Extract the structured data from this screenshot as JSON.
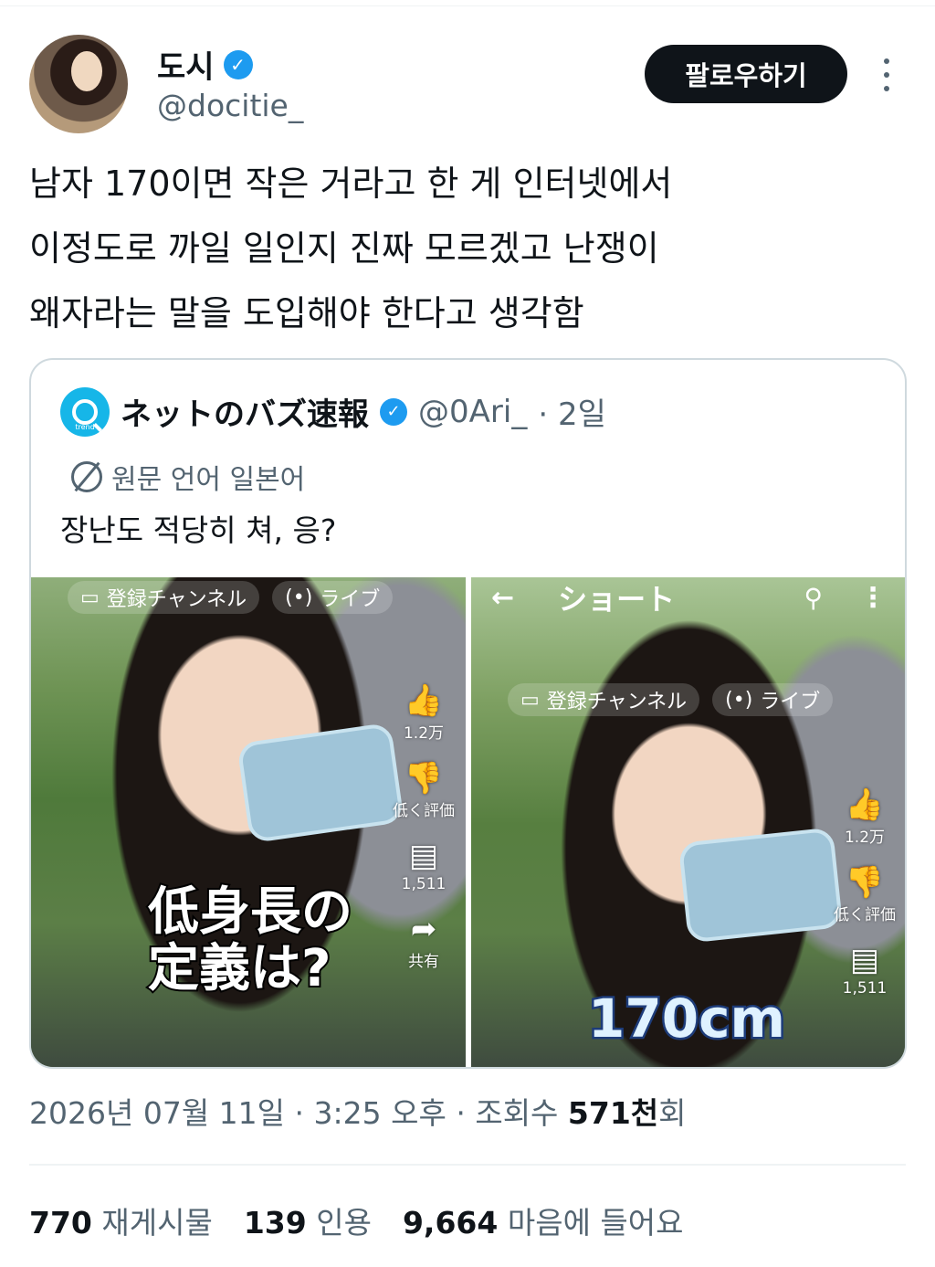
{
  "header": {
    "display_name": "도시",
    "handle": "@docitie_",
    "follow_label": "팔로우하기"
  },
  "tweet": {
    "lines": [
      "남자 170이면 작은 거라고 한 게 인터넷에서",
      "이정도로 까일 일인지 진짜 모르겠고 난쟁이",
      "왜자라는 말을 도입해야 한다고 생각함"
    ]
  },
  "quote": {
    "name": "ネットのバズ速報",
    "handle": "@0Ari_",
    "time": "· 2일",
    "avatar_label": "trend",
    "language_note": "원문 언어 일본어",
    "text": "장난도 적당히 쳐, 응?",
    "media_left": {
      "top_bar": [
        "登録チャンネル",
        "ライブ"
      ],
      "rail": [
        {
          "icon": "thumbs-up-icon",
          "label": "1.2万"
        },
        {
          "icon": "thumbs-down-icon",
          "label": "低く評価"
        },
        {
          "icon": "comment-icon",
          "label": "1,511"
        },
        {
          "icon": "share-icon",
          "label": "共有"
        }
      ],
      "caption_line1": "低身長の",
      "caption_line2": "定義は?"
    },
    "media_right": {
      "bar_title": "ショート",
      "top_bar": [
        "登録チャンネル",
        "ライブ"
      ],
      "rail": [
        {
          "icon": "thumbs-up-icon",
          "label": "1.2万"
        },
        {
          "icon": "thumbs-down-icon",
          "label": "低く評価"
        },
        {
          "icon": "comment-icon",
          "label": "1,511"
        }
      ],
      "caption": "170cm"
    }
  },
  "meta": {
    "date": "2026년 07월 11일",
    "time": "3:25 오후",
    "views_prefix": "조회수",
    "views_value": "571천",
    "views_suffix": "회"
  },
  "stats": {
    "retweets": "770",
    "retweets_label": "재게시물",
    "quotes": "139",
    "quotes_label": "인용",
    "likes": "9,664",
    "likes_label": "마음에 들어요"
  }
}
